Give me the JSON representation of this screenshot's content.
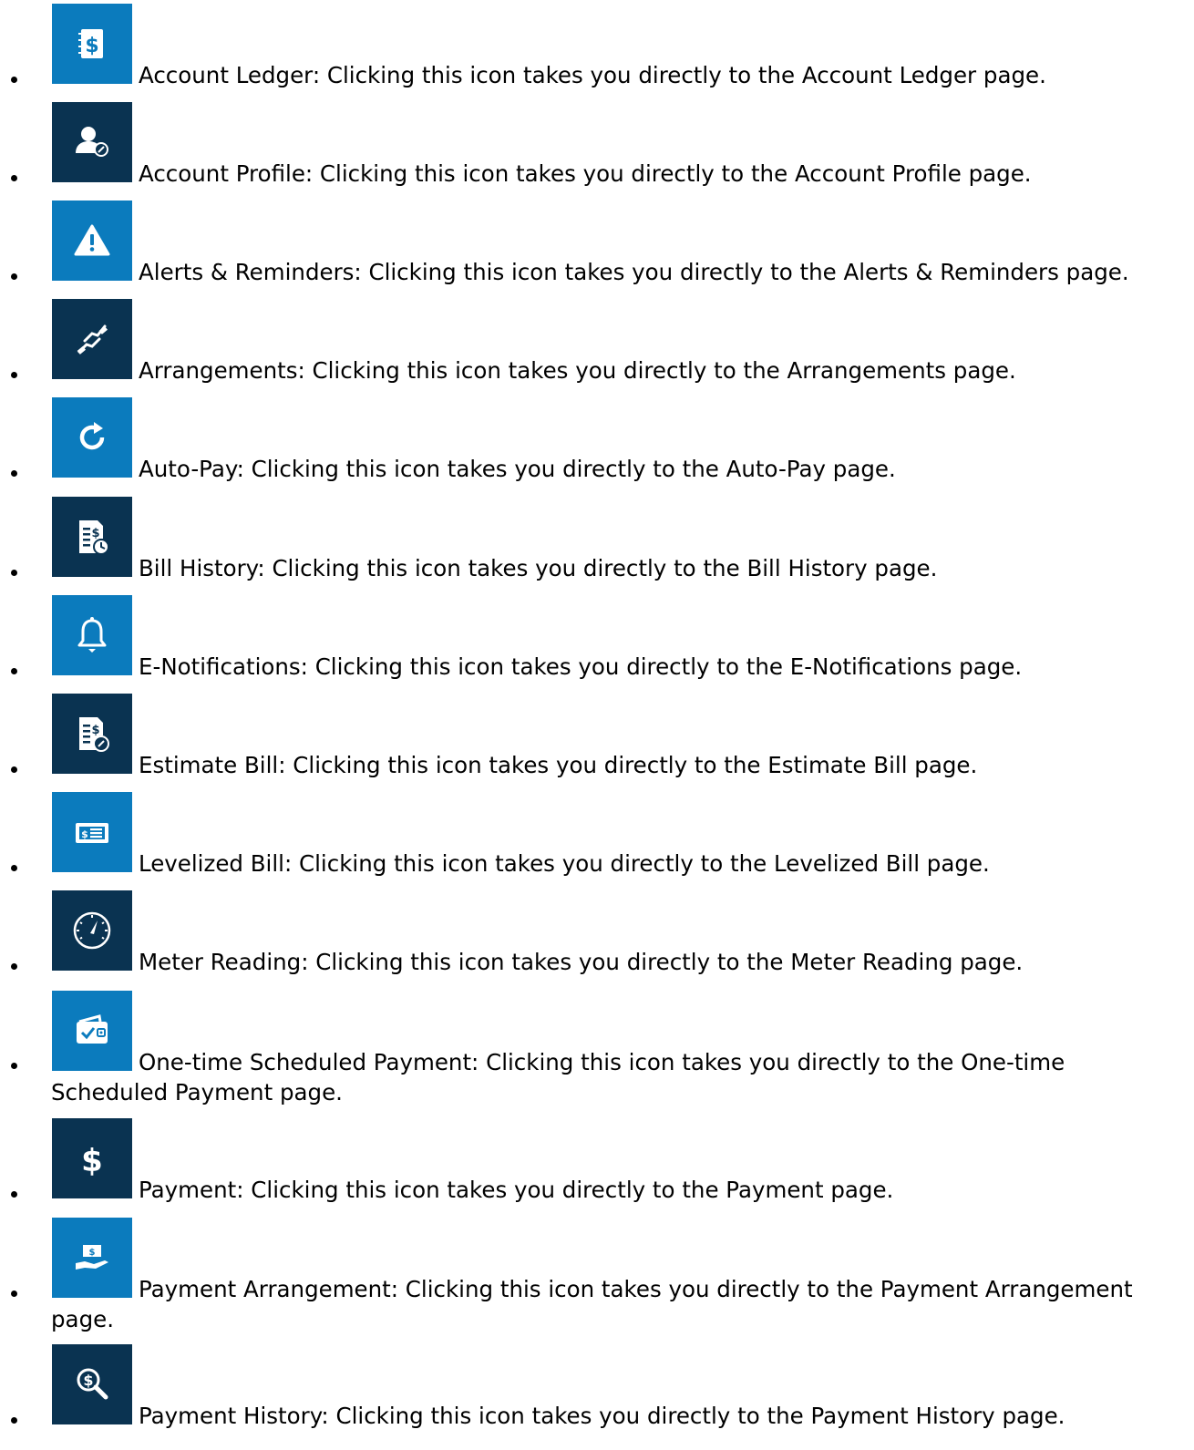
{
  "colors": {
    "light_tile": "#0b7bbd",
    "dark_tile": "#0a3351",
    "icon_fg": "#ffffff"
  },
  "items": [
    {
      "icon": "ledger-icon",
      "tile": "light",
      "text": "Account Ledger: Clicking this icon takes you directly to the Account Ledger page."
    },
    {
      "icon": "account-profile-icon",
      "tile": "dark",
      "text": "Account Profile: Clicking this icon takes you directly to the Account Profile page."
    },
    {
      "icon": "alert-icon",
      "tile": "light",
      "text": "Alerts & Reminders: Clicking this icon takes you directly to the Alerts & Reminders page."
    },
    {
      "icon": "handshake-icon",
      "tile": "dark",
      "text": "Arrangements: Clicking this icon takes you directly to the Arrangements page."
    },
    {
      "icon": "autopay-refresh-icon",
      "tile": "light",
      "text": "Auto-Pay: Clicking this icon takes you directly to the Auto-Pay page."
    },
    {
      "icon": "bill-history-icon",
      "tile": "dark",
      "text": "Bill History: Clicking this icon takes you directly to the Bill History page."
    },
    {
      "icon": "bell-icon",
      "tile": "light",
      "text": "E-Notifications: Clicking this icon takes you directly to the E-Notifications page."
    },
    {
      "icon": "estimate-bill-icon",
      "tile": "dark",
      "text": "Estimate Bill: Clicking this icon takes you directly to the Estimate Bill page."
    },
    {
      "icon": "levelized-bill-icon",
      "tile": "light",
      "text": "Levelized Bill: Clicking this icon takes you directly to the Levelized Bill page."
    },
    {
      "icon": "meter-gauge-icon",
      "tile": "dark",
      "text": "Meter Reading: Clicking this icon takes you directly to the Meter Reading page."
    },
    {
      "icon": "wallet-check-icon",
      "tile": "light",
      "text": "One-time Scheduled Payment: Clicking this icon takes you directly to the One-time",
      "text_cont": "Scheduled Payment page."
    },
    {
      "icon": "dollar-icon",
      "tile": "dark",
      "text": "Payment: Clicking this icon takes you directly to the Payment page."
    },
    {
      "icon": "payment-hand-icon",
      "tile": "light",
      "text": "Payment Arrangement: Clicking this icon takes you directly to the Payment Arrangement",
      "text_cont": "page."
    },
    {
      "icon": "payment-search-icon",
      "tile": "dark",
      "text": "Payment History: Clicking this icon takes you directly to the Payment History page."
    }
  ]
}
